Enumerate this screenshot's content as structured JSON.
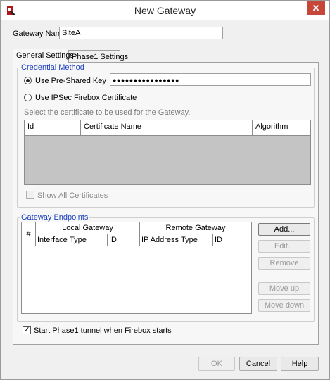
{
  "window": {
    "title": "New Gateway",
    "close_glyph": "✕",
    "app_icon": "watchguard-app-icon",
    "close_icon": "close-icon"
  },
  "gateway_name": {
    "label": "Gateway Name:",
    "value": "SiteA"
  },
  "tabs": [
    {
      "label": "General Settings",
      "selected": true
    },
    {
      "label": "Phase1 Settings",
      "selected": false
    }
  ],
  "credential_method": {
    "title": "Credential Method",
    "pre_shared_key_label": "Use Pre-Shared Key",
    "pre_shared_key_selected": true,
    "pre_shared_key_value": "●●●●●●●●●●●●●●●●",
    "ipsec_cert_label": "Use IPSec Firebox Certificate",
    "ipsec_cert_selected": false,
    "cert_hint": "Select the certificate to be used for the Gateway.",
    "cert_table_headers": [
      "Id",
      "Certificate Name",
      "Algorithm"
    ],
    "show_all_label": "Show All Certificates",
    "show_all_checked": false
  },
  "gateway_endpoints": {
    "title": "Gateway Endpoints",
    "hash_header": "#",
    "local_group": "Local Gateway",
    "remote_group": "Remote Gateway",
    "local_columns": [
      "Interface",
      "Type",
      "ID"
    ],
    "remote_columns": [
      "IP Address",
      "Type",
      "ID"
    ],
    "buttons": {
      "add": "Add...",
      "edit": "Edit...",
      "remove": "Remove",
      "move_up": "Move up",
      "move_down": "Move down"
    }
  },
  "start_phase1": {
    "label": "Start Phase1 tunnel when Firebox starts",
    "checked": true,
    "check_glyph": "✓"
  },
  "footer": {
    "ok": "OK",
    "cancel": "Cancel",
    "help": "Help"
  },
  "colors": {
    "group_title": "#1c3fbf",
    "close_button": "#c7463a",
    "disabled_area": "#c4c4c4"
  }
}
